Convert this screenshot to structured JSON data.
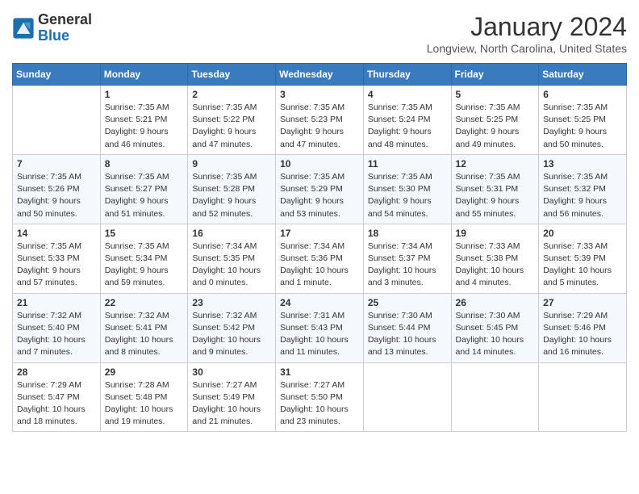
{
  "header": {
    "logo_line1": "General",
    "logo_line2": "Blue",
    "month": "January 2024",
    "location": "Longview, North Carolina, United States"
  },
  "days_of_week": [
    "Sunday",
    "Monday",
    "Tuesday",
    "Wednesday",
    "Thursday",
    "Friday",
    "Saturday"
  ],
  "weeks": [
    [
      {
        "day": "",
        "info": ""
      },
      {
        "day": "1",
        "info": "Sunrise: 7:35 AM\nSunset: 5:21 PM\nDaylight: 9 hours\nand 46 minutes."
      },
      {
        "day": "2",
        "info": "Sunrise: 7:35 AM\nSunset: 5:22 PM\nDaylight: 9 hours\nand 47 minutes."
      },
      {
        "day": "3",
        "info": "Sunrise: 7:35 AM\nSunset: 5:23 PM\nDaylight: 9 hours\nand 47 minutes."
      },
      {
        "day": "4",
        "info": "Sunrise: 7:35 AM\nSunset: 5:24 PM\nDaylight: 9 hours\nand 48 minutes."
      },
      {
        "day": "5",
        "info": "Sunrise: 7:35 AM\nSunset: 5:25 PM\nDaylight: 9 hours\nand 49 minutes."
      },
      {
        "day": "6",
        "info": "Sunrise: 7:35 AM\nSunset: 5:25 PM\nDaylight: 9 hours\nand 50 minutes."
      }
    ],
    [
      {
        "day": "7",
        "info": "Sunrise: 7:35 AM\nSunset: 5:26 PM\nDaylight: 9 hours\nand 50 minutes."
      },
      {
        "day": "8",
        "info": "Sunrise: 7:35 AM\nSunset: 5:27 PM\nDaylight: 9 hours\nand 51 minutes."
      },
      {
        "day": "9",
        "info": "Sunrise: 7:35 AM\nSunset: 5:28 PM\nDaylight: 9 hours\nand 52 minutes."
      },
      {
        "day": "10",
        "info": "Sunrise: 7:35 AM\nSunset: 5:29 PM\nDaylight: 9 hours\nand 53 minutes."
      },
      {
        "day": "11",
        "info": "Sunrise: 7:35 AM\nSunset: 5:30 PM\nDaylight: 9 hours\nand 54 minutes."
      },
      {
        "day": "12",
        "info": "Sunrise: 7:35 AM\nSunset: 5:31 PM\nDaylight: 9 hours\nand 55 minutes."
      },
      {
        "day": "13",
        "info": "Sunrise: 7:35 AM\nSunset: 5:32 PM\nDaylight: 9 hours\nand 56 minutes."
      }
    ],
    [
      {
        "day": "14",
        "info": "Sunrise: 7:35 AM\nSunset: 5:33 PM\nDaylight: 9 hours\nand 57 minutes."
      },
      {
        "day": "15",
        "info": "Sunrise: 7:35 AM\nSunset: 5:34 PM\nDaylight: 9 hours\nand 59 minutes."
      },
      {
        "day": "16",
        "info": "Sunrise: 7:34 AM\nSunset: 5:35 PM\nDaylight: 10 hours\nand 0 minutes."
      },
      {
        "day": "17",
        "info": "Sunrise: 7:34 AM\nSunset: 5:36 PM\nDaylight: 10 hours\nand 1 minute."
      },
      {
        "day": "18",
        "info": "Sunrise: 7:34 AM\nSunset: 5:37 PM\nDaylight: 10 hours\nand 3 minutes."
      },
      {
        "day": "19",
        "info": "Sunrise: 7:33 AM\nSunset: 5:38 PM\nDaylight: 10 hours\nand 4 minutes."
      },
      {
        "day": "20",
        "info": "Sunrise: 7:33 AM\nSunset: 5:39 PM\nDaylight: 10 hours\nand 5 minutes."
      }
    ],
    [
      {
        "day": "21",
        "info": "Sunrise: 7:32 AM\nSunset: 5:40 PM\nDaylight: 10 hours\nand 7 minutes."
      },
      {
        "day": "22",
        "info": "Sunrise: 7:32 AM\nSunset: 5:41 PM\nDaylight: 10 hours\nand 8 minutes."
      },
      {
        "day": "23",
        "info": "Sunrise: 7:32 AM\nSunset: 5:42 PM\nDaylight: 10 hours\nand 9 minutes."
      },
      {
        "day": "24",
        "info": "Sunrise: 7:31 AM\nSunset: 5:43 PM\nDaylight: 10 hours\nand 11 minutes."
      },
      {
        "day": "25",
        "info": "Sunrise: 7:30 AM\nSunset: 5:44 PM\nDaylight: 10 hours\nand 13 minutes."
      },
      {
        "day": "26",
        "info": "Sunrise: 7:30 AM\nSunset: 5:45 PM\nDaylight: 10 hours\nand 14 minutes."
      },
      {
        "day": "27",
        "info": "Sunrise: 7:29 AM\nSunset: 5:46 PM\nDaylight: 10 hours\nand 16 minutes."
      }
    ],
    [
      {
        "day": "28",
        "info": "Sunrise: 7:29 AM\nSunset: 5:47 PM\nDaylight: 10 hours\nand 18 minutes."
      },
      {
        "day": "29",
        "info": "Sunrise: 7:28 AM\nSunset: 5:48 PM\nDaylight: 10 hours\nand 19 minutes."
      },
      {
        "day": "30",
        "info": "Sunrise: 7:27 AM\nSunset: 5:49 PM\nDaylight: 10 hours\nand 21 minutes."
      },
      {
        "day": "31",
        "info": "Sunrise: 7:27 AM\nSunset: 5:50 PM\nDaylight: 10 hours\nand 23 minutes."
      },
      {
        "day": "",
        "info": ""
      },
      {
        "day": "",
        "info": ""
      },
      {
        "day": "",
        "info": ""
      }
    ]
  ]
}
